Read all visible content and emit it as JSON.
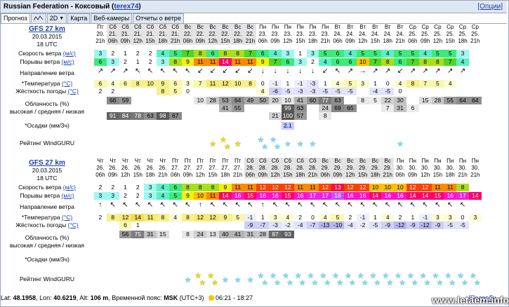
{
  "title": "Russian Federation - Коксовый",
  "user_link": "terex74",
  "options_link": "[Опции]",
  "tabs": [
    "Прогноз",
    "2D",
    "Карта",
    "Веб-камеры",
    "Отчеты о ветре"
  ],
  "labels": {
    "wind_speed": "Скорость ветра",
    "gusts": "Порывы ветра",
    "unit_ms": "(м/с)",
    "direction": "Направление ветра",
    "temperature": "*Температура",
    "windchill": "Жёсткость погоды",
    "unit_c": "(°C)",
    "clouds": "Облачность (%)",
    "clouds_levels": "высокая / средняя / низкая",
    "precip": "*Осадки (мм/3ч)",
    "rating": "Рейтинг WindGURU"
  },
  "model1": {
    "name": "GFS 27 km",
    "date": "20.03.2015",
    "utc": "18 UTC",
    "days": [
      "Пт",
      "Сб",
      "Сб",
      "Сб",
      "Сб",
      "Сб",
      "Сб",
      "Вс",
      "Вс",
      "Вс",
      "Вс",
      "Вс",
      "Вс",
      "Пн",
      "Пн",
      "Пн",
      "Пн",
      "Пн",
      "Пн",
      "Вт",
      "Вт",
      "Вт",
      "Вт",
      "Вт",
      "Вт",
      "Ср",
      "Ср",
      "Ср",
      "Ср",
      "Ср",
      "Ср"
    ],
    "dates": [
      "20.",
      "21.",
      "21.",
      "21.",
      "21.",
      "21.",
      "21.",
      "22.",
      "22.",
      "22.",
      "22.",
      "22.",
      "22.",
      "23.",
      "23.",
      "23.",
      "23.",
      "23.",
      "23.",
      "24.",
      "24.",
      "24.",
      "24.",
      "24.",
      "24.",
      "25.",
      "25.",
      "25.",
      "25.",
      "25.",
      "25."
    ],
    "hours": [
      "21h",
      "06h",
      "09h",
      "12h",
      "15h",
      "18h",
      "21h",
      "06h",
      "09h",
      "12h",
      "15h",
      "18h",
      "21h",
      "06h",
      "09h",
      "12h",
      "15h",
      "18h",
      "21h",
      "06h",
      "09h",
      "12h",
      "15h",
      "18h",
      "21h",
      "06h",
      "09h",
      "12h",
      "15h",
      "18h",
      "21h"
    ],
    "speed": [
      "3",
      "2",
      "1",
      "2",
      "2",
      "4",
      "5",
      "7",
      "8",
      "6",
      "8",
      "8",
      "7",
      "6",
      "4",
      "3",
      "1",
      "3",
      "5",
      "6",
      "4",
      "5",
      "5",
      "4",
      "5",
      "5",
      "4",
      "5",
      "5",
      "3"
    ],
    "gusts": [
      "6",
      "3",
      "2",
      "1",
      "2",
      "3",
      "8",
      "9",
      "11",
      "11",
      "14",
      "11",
      "11",
      "9",
      "7",
      "6",
      "3",
      "2",
      "4",
      "6",
      "6",
      "10",
      "7",
      "8",
      "6",
      "7",
      "8",
      "8",
      "7",
      "4"
    ],
    "dir": [
      "↗",
      "↗",
      "↗",
      "↖",
      "↖",
      "↖",
      "↖",
      "↖",
      "↙",
      "↙",
      "↙",
      "↙",
      "↙",
      "↓",
      "↓",
      "↓",
      "↓",
      "↓",
      "↙",
      "↖",
      "↗",
      "→",
      "↗",
      "↗",
      "↙",
      "↗",
      "↗",
      "↗",
      "↗",
      "↗"
    ],
    "temp": [
      "6",
      "4",
      "6",
      "8",
      "10",
      "9",
      "6",
      "3",
      "7",
      "11",
      "12",
      "10",
      "8",
      "0",
      "-1",
      "1",
      "-1",
      "-3",
      "1",
      "4",
      "5",
      "3",
      "1",
      "0",
      "4",
      "8",
      "7",
      "5",
      "4"
    ],
    "windchill": [
      "2",
      "2",
      "",
      "",
      "",
      "8",
      "5",
      "0",
      "",
      "",
      "",
      "",
      "",
      "4",
      "-6",
      "-5",
      "-3",
      "-3",
      "-5",
      "-5",
      "-5",
      "",
      "-4",
      "-5",
      "0",
      "",
      "",
      "",
      ""
    ],
    "cloud_h": [
      "",
      "66",
      "59",
      "",
      "",
      "",
      "",
      "",
      "10",
      "28",
      "53",
      "64",
      "49",
      "50",
      "20",
      "10",
      "41",
      "60",
      "77",
      "63",
      "",
      "8",
      "5",
      "22",
      "30",
      "",
      "15",
      "28",
      "55",
      "64",
      "64"
    ],
    "cloud_m": [
      "",
      "",
      "",
      "",
      "",
      "",
      "",
      "",
      "",
      "",
      "41",
      "55",
      "",
      "",
      "",
      "99",
      "63",
      "",
      "24",
      "69",
      "65",
      "",
      "",
      "7",
      "31",
      "6",
      "",
      "",
      "",
      "",
      ""
    ],
    "cloud_l": [
      "",
      "91",
      "84",
      "78",
      "63",
      "98",
      "67",
      "",
      "",
      "",
      "",
      "",
      "",
      "",
      "21",
      "100",
      "57",
      "",
      "8",
      "",
      "",
      "",
      "",
      "",
      "",
      "",
      "",
      "",
      "",
      "",
      ""
    ],
    "precip": [
      "",
      "",
      "",
      "",
      "",
      "",
      "",
      "",
      "",
      "",
      "",
      "",
      "",
      "",
      "",
      "2.1",
      "",
      "",
      "",
      "",
      "",
      "",
      "",
      "",
      "",
      "",
      "",
      "",
      "",
      "",
      ""
    ],
    "rating": [
      0,
      0,
      0,
      0,
      0,
      0,
      0,
      0,
      0,
      1,
      2,
      1,
      0,
      2,
      2,
      1,
      1,
      1,
      0,
      0,
      0,
      0,
      0,
      0,
      1,
      0,
      0,
      0,
      0,
      0,
      0
    ]
  },
  "model2": {
    "name": "GFS 27 km",
    "date": "20.03.2015",
    "utc": "18 UTC",
    "days": [
      "Чт",
      "Чт",
      "Чт",
      "Чт",
      "Чт",
      "Чт",
      "Пт",
      "Пт",
      "Пт",
      "Пт",
      "Пт",
      "Пт",
      "Сб",
      "Сб",
      "Сб",
      "Сб",
      "Сб",
      "Сб",
      "Вс",
      "Вс",
      "Вс",
      "Вс",
      "Вс",
      "Вс",
      "Пн",
      "Пн",
      "Пн",
      "Пн",
      "Пн",
      "Пн",
      "Пн"
    ],
    "dates": [
      "26.",
      "26.",
      "26.",
      "26.",
      "26.",
      "26.",
      "27.",
      "27.",
      "27.",
      "27.",
      "27.",
      "27.",
      "28.",
      "28.",
      "28.",
      "28.",
      "28.",
      "28.",
      "29.",
      "29.",
      "29.",
      "29.",
      "29.",
      "29.",
      "30.",
      "30.",
      "30.",
      "30.",
      "30.",
      "30.",
      "30."
    ],
    "hours": [
      "06h",
      "09h",
      "12h",
      "15h",
      "18h",
      "21h",
      "06h",
      "09h",
      "12h",
      "15h",
      "18h",
      "21h",
      "06h",
      "09h",
      "12h",
      "15h",
      "18h",
      "21h",
      "06h",
      "09h",
      "12h",
      "15h",
      "18h",
      "21h",
      "06h",
      "09h",
      "12h",
      "15h",
      "18h",
      "21h",
      "21h"
    ],
    "speed": [
      "2",
      "2",
      "1",
      "2",
      "3",
      "4",
      "6",
      "8",
      "8",
      "8",
      "9",
      "11",
      "11",
      "12",
      "12",
      "12",
      "11",
      "11",
      "12",
      "13",
      "12",
      "12",
      "10",
      "10",
      "10",
      "12",
      "12",
      "11",
      "11",
      "8"
    ],
    "gusts": [
      "3",
      "3",
      "2",
      "2",
      "3",
      "4",
      "5",
      "9",
      "10",
      "11",
      "14",
      "16",
      "15",
      "16",
      "16",
      "15",
      "16",
      "17",
      "17",
      "18",
      "16",
      "16",
      "14",
      "16",
      "16",
      "14",
      "14",
      "15",
      "16",
      "17",
      "14"
    ],
    "dir": [
      "↑",
      "↖",
      "↖",
      "↖",
      "↖",
      "↖",
      "↖",
      "↖",
      "↑",
      "↖",
      "↖",
      "↖",
      "↖",
      "↑",
      "↖",
      "↖",
      "↖",
      "↖",
      "↖",
      "↖",
      "↖",
      "↖",
      "↖",
      "↖",
      "↖",
      "↖",
      "↖",
      "↖",
      "↖",
      "↖"
    ],
    "temp": [
      "2",
      "8",
      "12",
      "14",
      "11",
      "8",
      "4",
      "8",
      "12",
      "12",
      "9",
      "5",
      "-1",
      "1",
      "3",
      "4",
      "2",
      "0",
      "4",
      "5",
      "2",
      "-1",
      "1",
      "4",
      "2",
      "1",
      "-1",
      "3",
      "3",
      "0",
      "3"
    ],
    "windchill": [
      "",
      "",
      "6",
      "1",
      "",
      "",
      "",
      "",
      "",
      "",
      "",
      "",
      "-9",
      "-7",
      "-3",
      "-2",
      "-4",
      "-7",
      "-13",
      "-10",
      "-4",
      "-2",
      "-5",
      "-9",
      "-12",
      "-9",
      "-12",
      "-9",
      "-5",
      "-5",
      ""
    ],
    "cloud_h": [
      "",
      "",
      "56",
      "75",
      "31",
      "15",
      "",
      "8",
      "24",
      "13",
      "40",
      "41",
      "31",
      "28",
      "87",
      "93",
      "",
      "",
      "",
      "",
      "",
      "",
      "",
      "",
      "",
      "",
      "",
      "",
      "",
      "",
      ""
    ],
    "cloud_m": [
      "",
      "",
      "",
      "",
      "",
      "",
      "",
      "",
      "",
      "",
      "",
      "",
      "",
      "",
      "",
      "",
      "",
      "",
      "",
      "",
      "",
      "",
      "",
      "",
      "",
      "",
      "",
      "",
      "",
      "",
      ""
    ],
    "cloud_l": [
      "",
      "",
      "",
      "",
      "",
      "",
      "",
      "",
      "",
      "",
      "",
      "",
      "",
      "",
      "",
      "",
      "",
      "",
      "",
      "",
      "",
      "",
      "",
      "",
      "",
      "",
      "",
      "",
      "",
      "",
      ""
    ],
    "precip": [
      "",
      "",
      "",
      "",
      "",
      "",
      "",
      "",
      "",
      "",
      "",
      "",
      "",
      "",
      "",
      "",
      "",
      "",
      "",
      "",
      "",
      "",
      "",
      "",
      "",
      "",
      "",
      "",
      "",
      "",
      ""
    ],
    "rating": [
      0,
      0,
      0,
      0,
      0,
      0,
      0,
      1,
      2,
      2,
      1,
      1,
      1,
      2,
      2,
      2,
      2,
      2,
      2,
      2,
      2,
      2,
      2,
      2,
      2,
      2,
      2,
      2,
      2,
      2,
      2
    ],
    "rating_yellow": [
      0,
      0,
      0,
      0,
      0,
      0,
      0,
      0,
      2,
      2,
      0,
      0,
      0,
      0,
      0,
      0,
      0,
      0,
      0,
      0,
      0,
      0,
      0,
      0,
      0,
      0,
      0,
      0,
      0,
      0,
      0
    ]
  },
  "footer": {
    "lat_label": "Lat:",
    "lat": "48.1958",
    "lon_label": "Lon:",
    "lon": "40.6219",
    "alt_label": "Alt:",
    "alt": "106 m",
    "tz_label": "Временной пояс:",
    "tz": "MSK",
    "tz_offset": "(UTC+3)",
    "sun": "06:21 - 18:27",
    "details_link": "[Подробн..."
  },
  "watermark": "www.letaem.info",
  "colors": {
    "link": "#1a3fa8",
    "header_bg": "#dfe7f2",
    "weekend_bg": "#e3e3e3"
  }
}
